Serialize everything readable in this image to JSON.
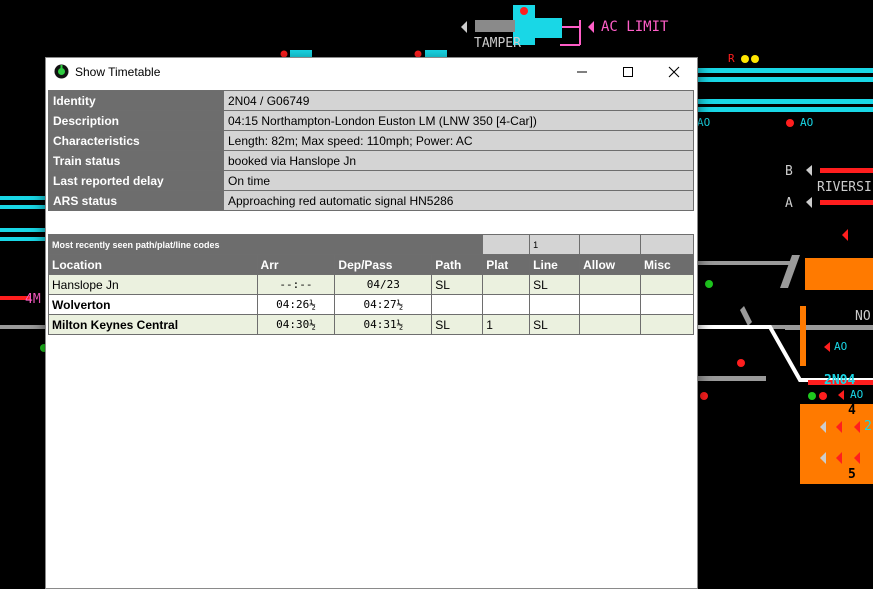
{
  "background": {
    "labels": {
      "ac_limit": "AC LIMIT",
      "tamper": "TAMPER",
      "riverside": "RIVERSI",
      "b": "B",
      "a": "A",
      "no": "NO",
      "4m": "4M",
      "headcode": "2N04",
      "ao1": "AO",
      "ao2": "AO",
      "ao3": "AO",
      "ao4": "AO",
      "ao5": "AO",
      "plat4": "4",
      "plat5": "5",
      "r1": "R",
      "two": "2"
    }
  },
  "window": {
    "title": "Show Timetable",
    "controls": {
      "minimize": "minimize",
      "maximize": "maximize",
      "close": "close"
    }
  },
  "info": [
    {
      "key": "Identity",
      "value": "2N04 / G06749"
    },
    {
      "key": "Description",
      "value": "04:15 Northampton-London Euston LM (LNW 350 [4-Car])"
    },
    {
      "key": "Characteristics",
      "value": "Length: 82m; Max speed: 110mph; Power: AC"
    },
    {
      "key": "Train status",
      "value": "booked via Hanslope Jn"
    },
    {
      "key": "Last reported delay",
      "value": "On time"
    },
    {
      "key": "ARS status",
      "value": "Approaching red automatic signal HN5286"
    }
  ],
  "timetable": {
    "codes_header": "Most recently seen path/plat/line codes",
    "codes": {
      "path": "",
      "plat": "1",
      "line": "",
      "allow": ""
    },
    "columns": [
      "Location",
      "Arr",
      "Dep/Pass",
      "Path",
      "Plat",
      "Line",
      "Allow",
      "Misc"
    ],
    "rows": [
      {
        "location": "Hanslope Jn",
        "arr": "--:--",
        "dep": "04/23",
        "path": "SL",
        "plat": "",
        "line": "SL",
        "allow": "",
        "misc": "",
        "bold": false
      },
      {
        "location": "Wolverton",
        "arr": "04:26½",
        "dep": "04:27½",
        "path": "",
        "plat": "",
        "line": "",
        "allow": "",
        "misc": "",
        "bold": true
      },
      {
        "location": "Milton Keynes Central",
        "arr": "04:30½",
        "dep": "04:31½",
        "path": "SL",
        "plat": "1",
        "line": "SL",
        "allow": "",
        "misc": "",
        "bold": true
      }
    ]
  },
  "colors": {
    "track_cyan": "#19d7e6",
    "signal_red": "#ff1e1e",
    "platform_orange": "#ff7a00",
    "header_grey": "#6d6d6d"
  }
}
